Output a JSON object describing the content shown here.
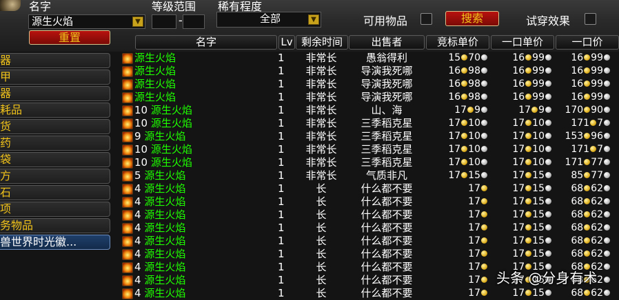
{
  "filters": {
    "name_label": "名字",
    "name_value": "源生火焰",
    "level_label": "等级范围",
    "level_sep": "-",
    "rarity_label": "稀有程度",
    "rarity_value": "全部",
    "usable_label": "可用物品",
    "search_label": "搜索",
    "tryon_label": "试穿效果",
    "reset_label": "重置"
  },
  "columns": {
    "name": "名字",
    "lv": "Lv",
    "time": "剩余时间",
    "seller": "出售者",
    "bid": "竞标单价",
    "buyout_unit": "一口单价",
    "buyout": "一口价"
  },
  "categories": [
    "器",
    "甲",
    "器",
    "耗品",
    "货",
    "药",
    "袋",
    "方",
    "石",
    "项",
    "务物品",
    "兽世界时光徽..."
  ],
  "selected_category": "兽世界时光徽...",
  "rows": [
    {
      "qty": "",
      "name": "源生火焰",
      "lv": "1",
      "time": "非常长",
      "seller": "愚翁得利",
      "bid": [
        "15",
        "70"
      ],
      "unit": [
        "16",
        "99"
      ],
      "buyout": [
        "16",
        "99"
      ]
    },
    {
      "qty": "",
      "name": "源生火焰",
      "lv": "1",
      "time": "非常长",
      "seller": "导演我死哪",
      "bid": [
        "16",
        "98"
      ],
      "unit": [
        "16",
        "99"
      ],
      "buyout": [
        "16",
        "99"
      ]
    },
    {
      "qty": "",
      "name": "源生火焰",
      "lv": "1",
      "time": "非常长",
      "seller": "导演我死哪",
      "bid": [
        "16",
        "98"
      ],
      "unit": [
        "16",
        "99"
      ],
      "buyout": [
        "16",
        "99"
      ]
    },
    {
      "qty": "",
      "name": "源生火焰",
      "lv": "1",
      "time": "非常长",
      "seller": "导演我死哪",
      "bid": [
        "16",
        "98"
      ],
      "unit": [
        "16",
        "99"
      ],
      "buyout": [
        "16",
        "99"
      ]
    },
    {
      "qty": "10",
      "name": "源生火焰",
      "lv": "1",
      "time": "非常长",
      "seller": "山、海",
      "bid": [
        "17",
        "9"
      ],
      "unit": [
        "17",
        "9"
      ],
      "buyout": [
        "170",
        "90"
      ]
    },
    {
      "qty": "10",
      "name": "源生火焰",
      "lv": "1",
      "time": "非常长",
      "seller": "三季稻克星",
      "bid": [
        "17",
        "10"
      ],
      "unit": [
        "17",
        "10"
      ],
      "buyout": [
        "171",
        "7"
      ]
    },
    {
      "qty": "9",
      "name": "源生火焰",
      "lv": "1",
      "time": "非常长",
      "seller": "三季稻克星",
      "bid": [
        "17",
        "10"
      ],
      "unit": [
        "17",
        "10"
      ],
      "buyout": [
        "153",
        "96"
      ]
    },
    {
      "qty": "10",
      "name": "源生火焰",
      "lv": "1",
      "time": "非常长",
      "seller": "三季稻克星",
      "bid": [
        "17",
        "10"
      ],
      "unit": [
        "17",
        "10"
      ],
      "buyout": [
        "171",
        "7"
      ]
    },
    {
      "qty": "10",
      "name": "源生火焰",
      "lv": "1",
      "time": "非常长",
      "seller": "三季稻克星",
      "bid": [
        "17",
        "10"
      ],
      "unit": [
        "17",
        "10"
      ],
      "buyout": [
        "171",
        "77"
      ]
    },
    {
      "qty": "5",
      "name": "源生火焰",
      "lv": "1",
      "time": "非常长",
      "seller": "气质非凡",
      "bid": [
        "17",
        "15"
      ],
      "unit": [
        "17",
        "15"
      ],
      "buyout": [
        "85",
        "77"
      ]
    },
    {
      "qty": "4",
      "name": "源生火焰",
      "lv": "1",
      "time": "长",
      "seller": "什么都不要",
      "bid": [
        "17",
        ""
      ],
      "unit": [
        "17",
        "15"
      ],
      "buyout": [
        "68",
        "62"
      ]
    },
    {
      "qty": "4",
      "name": "源生火焰",
      "lv": "1",
      "time": "长",
      "seller": "什么都不要",
      "bid": [
        "17",
        ""
      ],
      "unit": [
        "17",
        "15"
      ],
      "buyout": [
        "68",
        "62"
      ]
    },
    {
      "qty": "4",
      "name": "源生火焰",
      "lv": "1",
      "time": "长",
      "seller": "什么都不要",
      "bid": [
        "17",
        ""
      ],
      "unit": [
        "17",
        "15"
      ],
      "buyout": [
        "68",
        "62"
      ]
    },
    {
      "qty": "4",
      "name": "源生火焰",
      "lv": "1",
      "time": "长",
      "seller": "什么都不要",
      "bid": [
        "17",
        ""
      ],
      "unit": [
        "17",
        "15"
      ],
      "buyout": [
        "68",
        "62"
      ]
    },
    {
      "qty": "4",
      "name": "源生火焰",
      "lv": "1",
      "time": "长",
      "seller": "什么都不要",
      "bid": [
        "17",
        ""
      ],
      "unit": [
        "17",
        "15"
      ],
      "buyout": [
        "68",
        "62"
      ]
    },
    {
      "qty": "4",
      "name": "源生火焰",
      "lv": "1",
      "time": "长",
      "seller": "什么都不要",
      "bid": [
        "17",
        ""
      ],
      "unit": [
        "17",
        "15"
      ],
      "buyout": [
        "68",
        "62"
      ]
    },
    {
      "qty": "4",
      "name": "源生火焰",
      "lv": "1",
      "time": "长",
      "seller": "什么都不要",
      "bid": [
        "17",
        ""
      ],
      "unit": [
        "17",
        "15"
      ],
      "buyout": [
        "68",
        "62"
      ]
    },
    {
      "qty": "4",
      "name": "源生火焰",
      "lv": "1",
      "time": "长",
      "seller": "什么都不要",
      "bid": [
        "17",
        ""
      ],
      "unit": [
        "17",
        "15"
      ],
      "buyout": [
        "68",
        "62"
      ]
    },
    {
      "qty": "4",
      "name": "源生火焰",
      "lv": "1",
      "time": "长",
      "seller": "什么都不要",
      "bid": [
        "17",
        ""
      ],
      "unit": [
        "17",
        "15"
      ],
      "buyout": [
        "68",
        "62"
      ]
    }
  ],
  "watermark": "头条 @分身有术",
  "colors": {
    "gold_text": "#f0c21a",
    "item_green": "#1eff00",
    "button_red": "#b8120e",
    "selected_blue": "#1f3f6a"
  }
}
